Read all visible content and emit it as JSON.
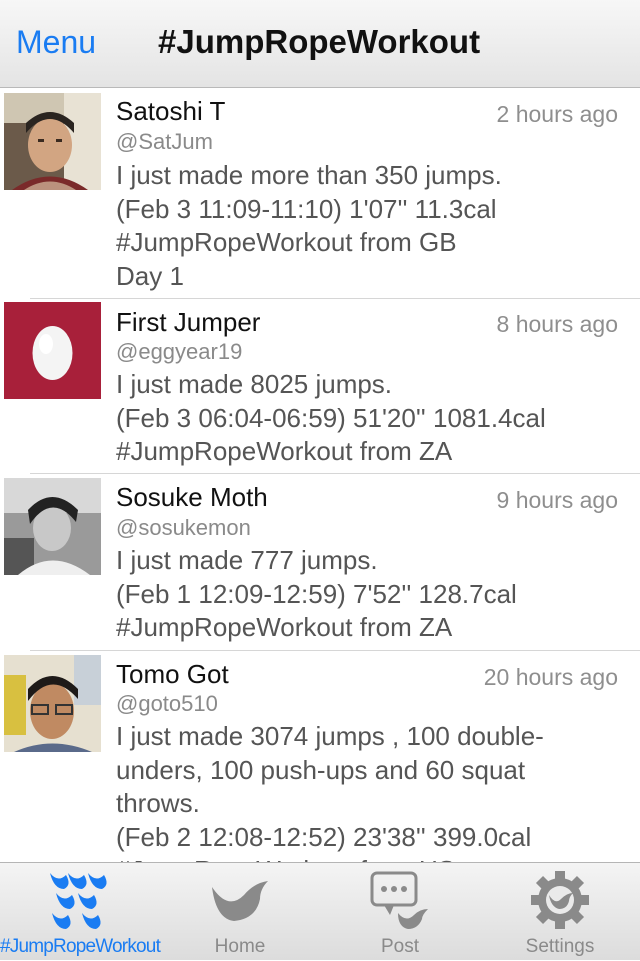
{
  "header": {
    "menu_label": "Menu",
    "title": "#JumpRopeWorkout"
  },
  "posts": [
    {
      "name": "Satoshi T",
      "handle": "@SatJum",
      "time": "2 hours ago",
      "lines": [
        "I just made more than 350 jumps.",
        "(Feb 3 11:09-11:10) 1'07'' 11.3cal",
        "#JumpRopeWorkout from GB",
        "Day 1"
      ],
      "avatar": "person-photo"
    },
    {
      "name": "First Jumper",
      "handle": "@eggyear19",
      "time": "8 hours ago",
      "lines": [
        "I just made 8025 jumps.",
        "(Feb 3 06:04-06:59) 51'20'' 1081.4cal",
        "#JumpRopeWorkout from ZA"
      ],
      "avatar": "egg-icon"
    },
    {
      "name": "Sosuke Moth",
      "handle": "@sosukemon",
      "time": "9 hours ago",
      "lines": [
        "I just made 777 jumps.",
        "(Feb 1 12:09-12:59) 7'52'' 128.7cal",
        "#JumpRopeWorkout from ZA"
      ],
      "avatar": "person-photo-bw"
    },
    {
      "name": "Tomo Got",
      "handle": "@goto510",
      "time": "20 hours ago",
      "lines": [
        "I just made 3074 jumps , 100 double-",
        "unders, 100 push-ups and 60 squat",
        "throws.",
        "(Feb 2 12:08-12:52) 23'38'' 399.0cal",
        "#JumpRopeWorkout from US"
      ],
      "avatar": "person-photo-glasses"
    }
  ],
  "tabs": [
    {
      "label": "#JumpRopeWorkout",
      "icon": "birds-flock-icon",
      "active": true
    },
    {
      "label": "Home",
      "icon": "bird-icon",
      "active": false
    },
    {
      "label": "Post",
      "icon": "speech-bubble-bird-icon",
      "active": false
    },
    {
      "label": "Settings",
      "icon": "gear-bird-icon",
      "active": false
    }
  ],
  "colors": {
    "accent": "#1a7cf2",
    "egg_background": "#a8203a"
  }
}
